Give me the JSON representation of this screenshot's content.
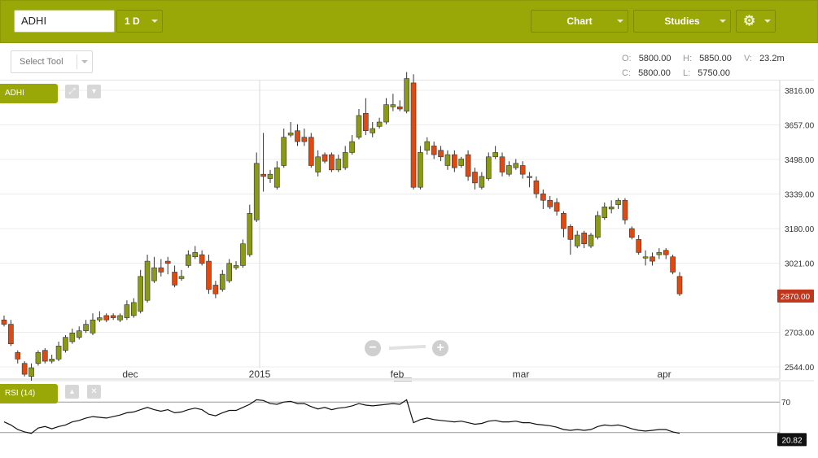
{
  "toolbar": {
    "symbol": "ADHI",
    "period": "1 D",
    "chart_label": "Chart",
    "studies_label": "Studies",
    "settings_icon": "gear-icon"
  },
  "select_tool": "Select Tool",
  "ohlc": {
    "o_label": "O:",
    "o": "5800.00",
    "h_label": "H:",
    "h": "5850.00",
    "v_label": "V:",
    "v": "23.2m",
    "c_label": "C:",
    "c": "5800.00",
    "l_label": "L:",
    "l": "5750.00"
  },
  "main_panel": {
    "label": "ADHI",
    "expand_icon": "expand-icon",
    "down_icon": "arrow-down-icon"
  },
  "rsi_panel": {
    "label": "RSI (14)",
    "up_icon": "arrow-up-icon",
    "close_icon": "close-icon"
  },
  "zoom": {
    "minus": "−",
    "plus": "+"
  },
  "colors": {
    "accent": "#99a806",
    "up": "#8a9a16",
    "down": "#e04a10",
    "last_price_bg": "#c0361d",
    "rsi_bg": "#111111"
  },
  "chart_data": [
    {
      "type": "candlestick",
      "title": "",
      "x_tick_labels": [
        "dec",
        "2015",
        "feb",
        "mar",
        "apr"
      ],
      "y_tick_labels": [
        "3816.00",
        "3657.00",
        "3498.00",
        "3339.00",
        "3180.00",
        "3021.00",
        "2703.00",
        "2544.00"
      ],
      "ylim": [
        2450,
        3940
      ],
      "last_price": "2870.00",
      "grid": true,
      "series": {
        "open": [
          2760,
          2740,
          2610,
          2560,
          2500,
          2560,
          2620,
          2570,
          2580,
          2620,
          2660,
          2680,
          2710,
          2700,
          2760,
          2780,
          2780,
          2760,
          2770,
          2780,
          2800,
          2850,
          2940,
          3000,
          3030,
          2980,
          2950,
          3010,
          3050,
          3060,
          3030,
          2920,
          2900,
          2940,
          3000,
          3010,
          3060,
          3220,
          3430,
          3410,
          3370,
          3470,
          3610,
          3630,
          3600,
          3600,
          3440,
          3520,
          3520,
          3450,
          3460,
          3530,
          3600,
          3710,
          3620,
          3650,
          3670,
          3740,
          3740,
          3720,
          3850,
          3370,
          3540,
          3560,
          3540,
          3470,
          3520,
          3470,
          3520,
          3440,
          3370,
          3410,
          3510,
          3510,
          3430,
          3460,
          3470,
          3420,
          3400,
          3340,
          3310,
          3300,
          3250,
          3190,
          3100,
          3160,
          3100,
          3140,
          3230,
          3270,
          3290,
          3310,
          3180,
          3130,
          3050,
          3050,
          3060,
          3080,
          3050,
          2960
        ],
        "close": [
          2740,
          2650,
          2580,
          2510,
          2540,
          2610,
          2570,
          2580,
          2640,
          2680,
          2700,
          2710,
          2740,
          2760,
          2770,
          2760,
          2770,
          2780,
          2830,
          2840,
          2960,
          3030,
          3000,
          2980,
          3020,
          2920,
          2960,
          3060,
          3070,
          3020,
          2900,
          2880,
          2970,
          3020,
          3010,
          3110,
          3250,
          3480,
          3420,
          3430,
          3460,
          3600,
          3620,
          3580,
          3580,
          3470,
          3510,
          3490,
          3450,
          3500,
          3530,
          3580,
          3700,
          3630,
          3640,
          3670,
          3750,
          3750,
          3730,
          3870,
          3370,
          3530,
          3580,
          3520,
          3510,
          3520,
          3460,
          3500,
          3420,
          3390,
          3420,
          3510,
          3530,
          3440,
          3470,
          3480,
          3430,
          3420,
          3340,
          3310,
          3280,
          3260,
          3180,
          3130,
          3150,
          3110,
          3150,
          3240,
          3280,
          3280,
          3310,
          3220,
          3140,
          3070,
          3050,
          3030,
          3070,
          3060,
          2980,
          2880
        ],
        "high": [
          2780,
          2760,
          2620,
          2570,
          2560,
          2620,
          2630,
          2600,
          2660,
          2690,
          2720,
          2730,
          2760,
          2790,
          2800,
          2790,
          2790,
          2790,
          2850,
          2860,
          2990,
          3060,
          3050,
          3040,
          3050,
          3010,
          2990,
          3080,
          3100,
          3080,
          3060,
          2940,
          2990,
          3040,
          3030,
          3130,
          3290,
          3530,
          3620,
          3450,
          3490,
          3640,
          3670,
          3660,
          3640,
          3620,
          3540,
          3530,
          3530,
          3520,
          3560,
          3610,
          3730,
          3780,
          3670,
          3690,
          3780,
          3800,
          3770,
          3900,
          3890,
          3560,
          3600,
          3580,
          3560,
          3540,
          3540,
          3510,
          3540,
          3460,
          3440,
          3530,
          3560,
          3530,
          3490,
          3500,
          3490,
          3440,
          3420,
          3360,
          3330,
          3320,
          3260,
          3200,
          3170,
          3170,
          3160,
          3260,
          3300,
          3310,
          3320,
          3320,
          3190,
          3150,
          3080,
          3070,
          3090,
          3090,
          3060,
          2980
        ],
        "low": [
          2730,
          2640,
          2560,
          2500,
          2480,
          2550,
          2560,
          2560,
          2570,
          2610,
          2650,
          2670,
          2700,
          2690,
          2750,
          2750,
          2760,
          2750,
          2760,
          2770,
          2790,
          2840,
          2930,
          2960,
          2970,
          2910,
          2940,
          3000,
          3040,
          3010,
          2880,
          2860,
          2890,
          2930,
          2990,
          3000,
          3050,
          3210,
          3350,
          3390,
          3360,
          3460,
          3600,
          3560,
          3560,
          3460,
          3420,
          3480,
          3440,
          3440,
          3450,
          3520,
          3590,
          3610,
          3600,
          3640,
          3660,
          3720,
          3720,
          3710,
          3360,
          3360,
          3520,
          3500,
          3490,
          3450,
          3440,
          3460,
          3400,
          3360,
          3360,
          3400,
          3500,
          3420,
          3420,
          3450,
          3410,
          3370,
          3320,
          3270,
          3270,
          3240,
          3140,
          3060,
          3090,
          3090,
          3090,
          3130,
          3220,
          3250,
          3270,
          3200,
          3130,
          3060,
          3010,
          3010,
          3040,
          3040,
          2970,
          2870
        ]
      }
    },
    {
      "type": "line",
      "title": "RSI (14)",
      "y_tick_labels": [
        "70"
      ],
      "last_value": "20.82",
      "values": [
        44,
        40,
        34,
        31,
        29,
        36,
        38,
        35,
        38,
        40,
        44,
        46,
        49,
        51,
        50,
        49,
        51,
        53,
        56,
        57,
        60,
        63,
        60,
        58,
        60,
        56,
        57,
        60,
        62,
        60,
        54,
        52,
        56,
        59,
        59,
        63,
        67,
        73,
        72,
        68,
        67,
        70,
        71,
        68,
        68,
        64,
        61,
        63,
        60,
        62,
        63,
        65,
        68,
        66,
        65,
        66,
        67,
        68,
        67,
        73,
        43,
        47,
        49,
        47,
        46,
        45,
        44,
        45,
        43,
        41,
        42,
        45,
        46,
        44,
        44,
        45,
        43,
        43,
        41,
        40,
        39,
        37,
        34,
        33,
        34,
        33,
        34,
        38,
        40,
        39,
        40,
        38,
        35,
        33,
        32,
        33,
        34,
        34,
        31,
        29
      ]
    }
  ]
}
